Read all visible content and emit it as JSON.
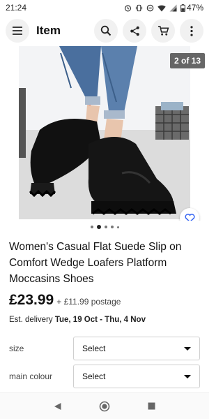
{
  "status_bar": {
    "time": "21:24",
    "battery": "47%"
  },
  "header": {
    "title": "Item",
    "icons": [
      "menu-icon",
      "search-icon",
      "share-icon",
      "cart-icon",
      "more-vert-icon"
    ]
  },
  "gallery": {
    "counter": "2 of 13",
    "image_count": 13,
    "current_index": 2
  },
  "product": {
    "title": "Women's Casual Flat Suede Slip on Comfort Wedge Loafers Platform Moccasins Shoes",
    "price": "£23.99",
    "postage": "+ £11.99 postage",
    "delivery_prefix": "Est. delivery ",
    "delivery_dates": "Tue, 19 Oct - Thu, 4 Nov"
  },
  "options": [
    {
      "label": "size",
      "value": "Select"
    },
    {
      "label": "main colour",
      "value": "Select"
    }
  ],
  "colors": {
    "accent": "#3665f3",
    "text": "#111111"
  }
}
